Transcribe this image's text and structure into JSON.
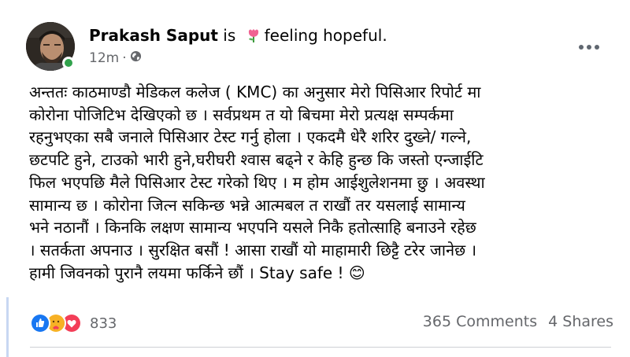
{
  "post": {
    "author": "Prakash Saput",
    "is_word": "is",
    "feeling": "feeling hopeful.",
    "time": "12m",
    "separator": "·",
    "audience_icon": "globe-icon",
    "more_icon": "more-options-icon",
    "text_lines": [
      "अन्ततः काठमाण्डौ मेडिकल कलेज ( KMC) का  अनुसार मेरो पिसिआर रिपोर्ट मा",
      "कोरोना पोजिटिभ देखिएको छ । सर्वप्रथम त यो बिचमा मेरो प्रत्यक्ष सम्पर्कमा",
      "रहनुभएका सबै जनाले पिसिआर टेस्ट गर्नु होला । एकदमै धेरै शरिर दुख्ने/  गल्ने,",
      "छटपटि हुने, टाउको भारी हुने,घरीघरी श्वास बढ्ने र केहि हुन्छ कि जस्तो एन्जाईटि",
      "फिल भएपछि मैले पिसिआर टेस्ट गरेको थिए । म होम आईशुलेशनमा छु । अवस्था",
      "सामान्य छ । कोरोना जित्न सकिन्छ भन्ने आत्मबल त राखौं तर यसलाई सामान्य",
      "भने नठानौं । किनकि लक्षण सामान्य भएपनि यसले निकै हतोत्साहि बनाउने रहेछ",
      "। सतर्कता अपनाउ । सुरक्षित बसौं ! आसा राखौं यो माहामारी छिट्टै टरेर जानेछ ।",
      "हामी जिवनको पुरानै लयमा फर्किने छौं । Stay safe ! 😊"
    ],
    "reactions": {
      "icons": [
        "like-icon",
        "care-icon",
        "love-icon"
      ],
      "count": "833"
    },
    "comments": "365 Comments",
    "shares": "4 Shares",
    "colors": {
      "like": "#1877f2",
      "care": "#f7b125",
      "love": "#f33e58",
      "online": "#31a24c",
      "muted": "#65676b"
    }
  }
}
